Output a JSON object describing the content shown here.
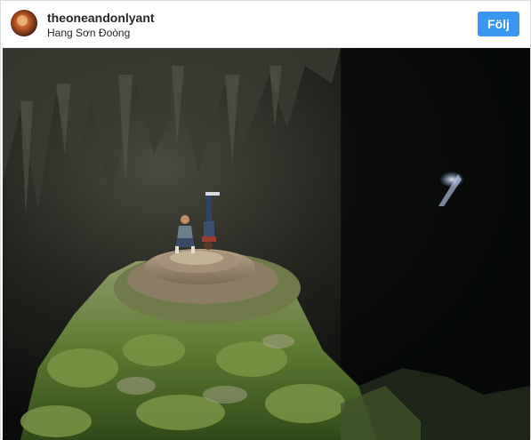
{
  "post": {
    "username": "theoneandonlyant",
    "location": "Hang Sơn Đoòng",
    "follow_label": "Följ"
  },
  "colors": {
    "follow_button": "#3897f0",
    "text": "#262626",
    "border": "#dbdbdb"
  },
  "icons": {
    "avatar": "profile-avatar-image"
  }
}
